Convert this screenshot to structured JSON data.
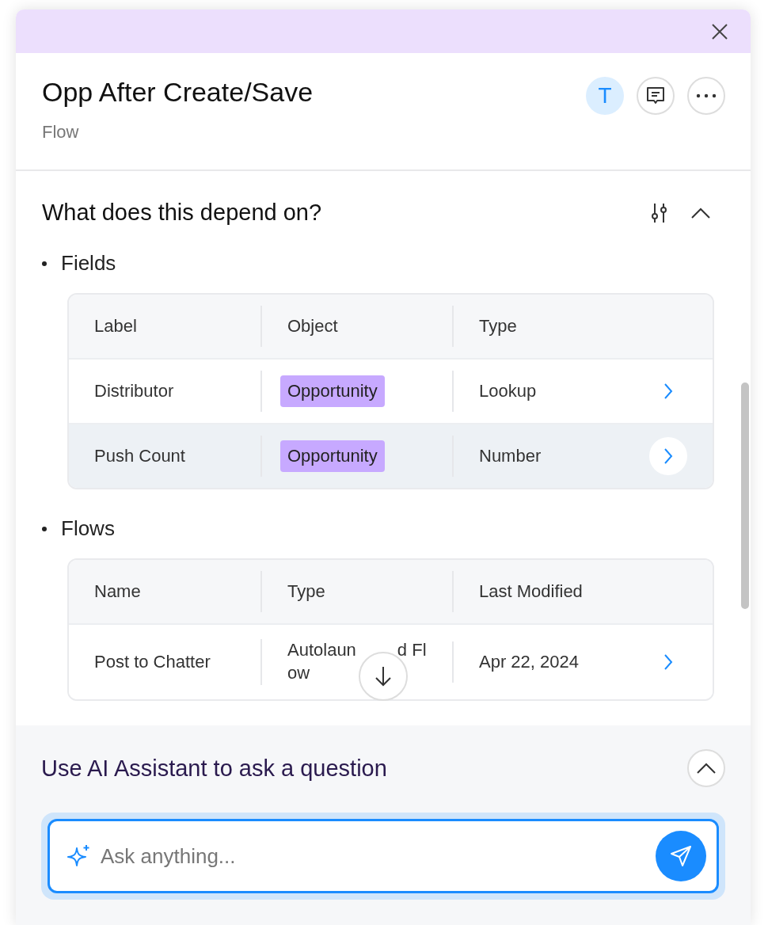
{
  "panel": {
    "title": "Opp After Create/Save",
    "subtitle": "Flow",
    "avatar": "T"
  },
  "dependencies": {
    "heading": "What does this depend on?",
    "expanded": true,
    "groups": [
      {
        "title": "Fields",
        "columns": [
          "Label",
          "Object",
          "Type"
        ],
        "rows": [
          {
            "selected": false,
            "cells": [
              {
                "kind": "text",
                "text": "Distributor"
              },
              {
                "kind": "tag",
                "text": "Opportunity"
              },
              {
                "kind": "text",
                "text": "Lookup"
              }
            ]
          },
          {
            "selected": true,
            "cells": [
              {
                "kind": "text",
                "text": "Push Count"
              },
              {
                "kind": "tag",
                "text": "Opportunity"
              },
              {
                "kind": "text",
                "text": "Number"
              }
            ]
          }
        ]
      },
      {
        "title": "Flows",
        "columns": [
          "Name",
          "Type",
          "Last Modified"
        ],
        "rows": [
          {
            "selected": false,
            "cells": [
              {
                "kind": "text",
                "text": "Post to Chatter"
              },
              {
                "kind": "covered",
                "line_1": [
                  "Autolaun",
                  "d Fl"
                ],
                "line_2": "ow"
              },
              {
                "kind": "text",
                "text": "Apr 22, 2024"
              }
            ]
          }
        ]
      }
    ]
  },
  "assistant": {
    "title": "Use AI Assistant to ask a question",
    "expanded": true,
    "placeholder": "Ask anything..."
  }
}
